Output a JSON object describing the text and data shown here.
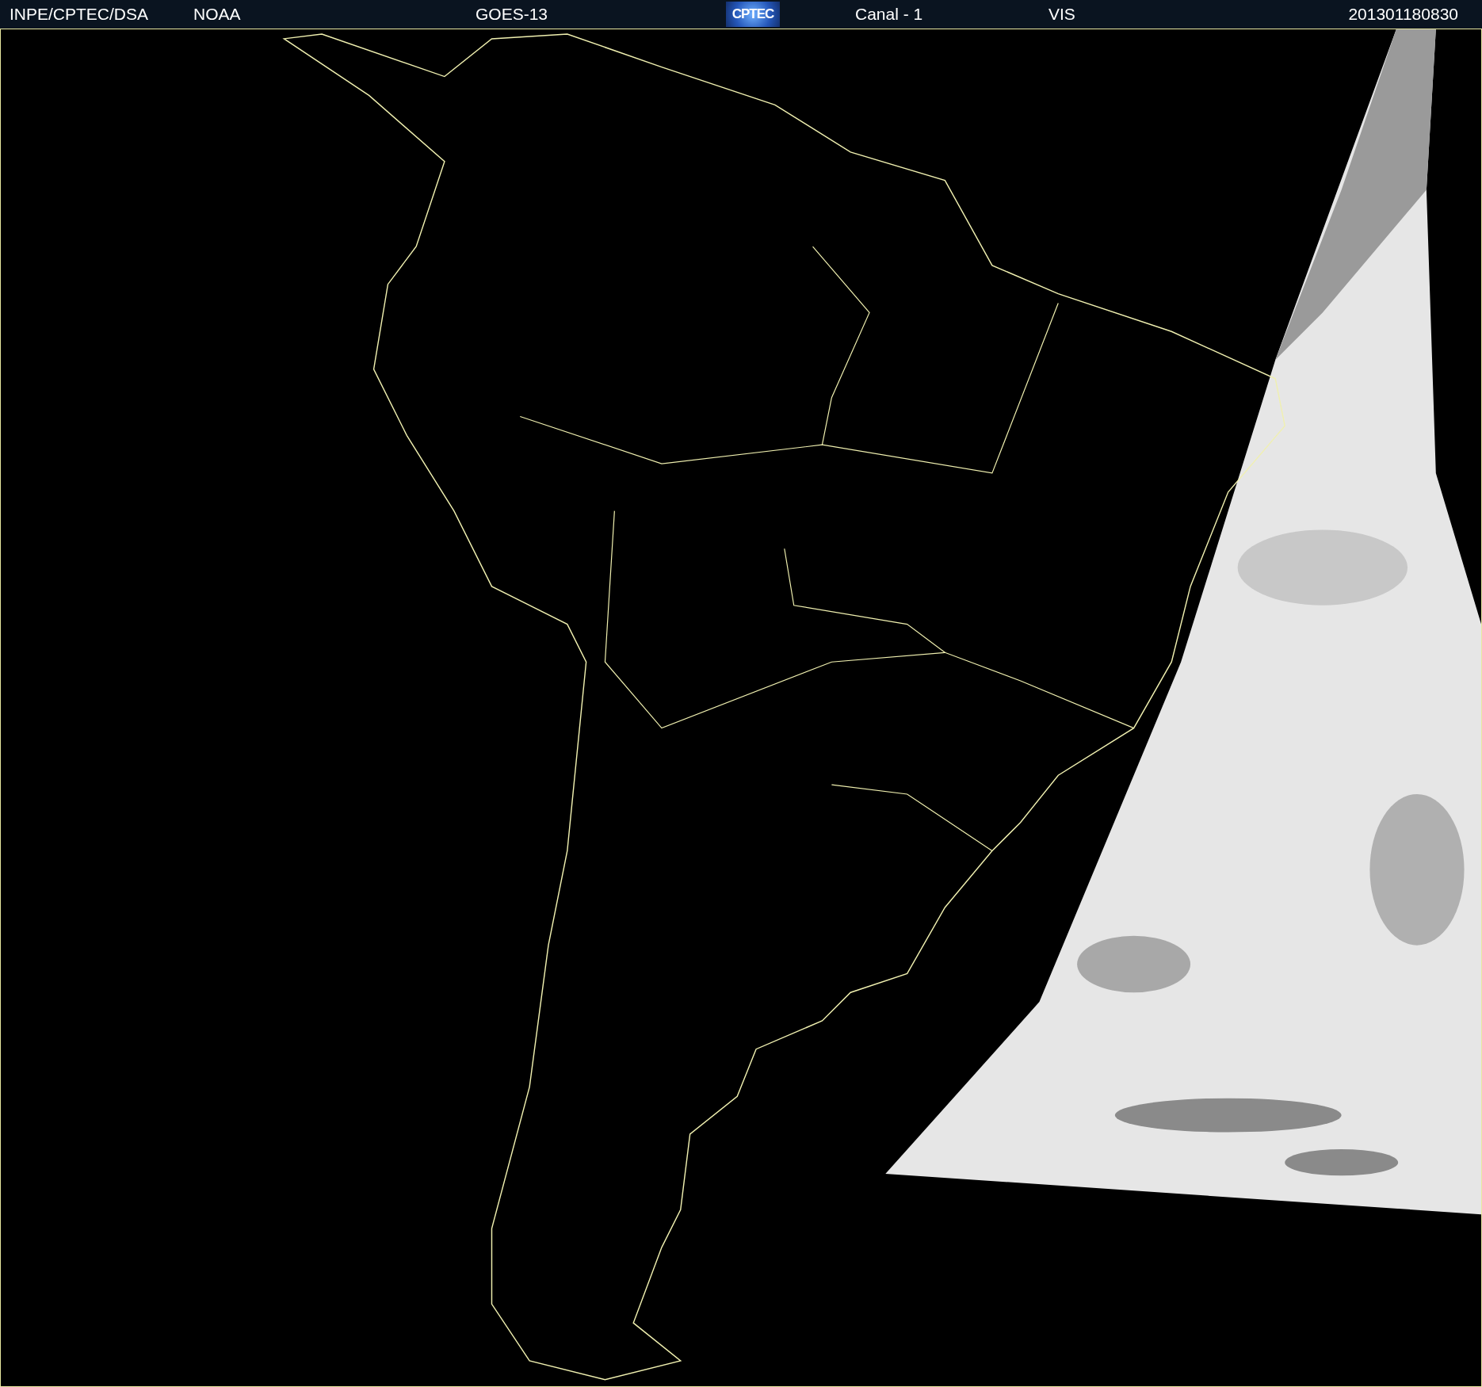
{
  "header": {
    "items": [
      {
        "kind": "text",
        "text": "INPE/CPTEC/DSA"
      },
      {
        "kind": "text",
        "text": "NOAA"
      },
      {
        "kind": "text",
        "text": "GOES-13"
      },
      {
        "kind": "logo",
        "text": "CPTEC"
      },
      {
        "kind": "text",
        "text": "Canal - 1"
      },
      {
        "kind": "text",
        "text": "VIS"
      },
      {
        "kind": "text",
        "text": "201301180830"
      }
    ]
  }
}
